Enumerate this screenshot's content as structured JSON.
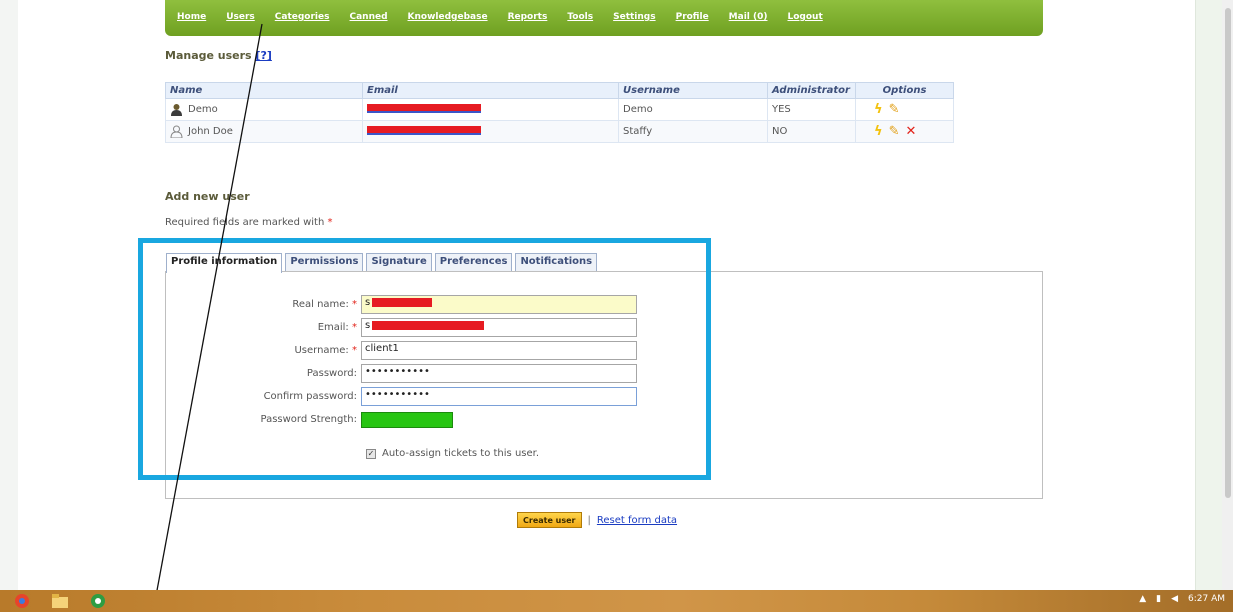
{
  "nav": {
    "items": [
      "Home",
      "Users",
      "Categories",
      "Canned",
      "Knowledgebase",
      "Reports",
      "Tools",
      "Settings",
      "Profile",
      "Mail (0)",
      "Logout"
    ]
  },
  "manage_users": {
    "title": "Manage users",
    "help": "[?]"
  },
  "users_table": {
    "headers": [
      "Name",
      "Email",
      "Username",
      "Administrator",
      "Options"
    ],
    "rows": [
      {
        "name": "Demo",
        "username": "Demo",
        "admin": "YES"
      },
      {
        "name": "John Doe",
        "username": "Staffy",
        "admin": "NO"
      }
    ]
  },
  "add_user": {
    "title": "Add new user",
    "required_note": "Required fields are marked with",
    "required_star": "*"
  },
  "tabs": [
    "Profile information",
    "Permissions",
    "Signature",
    "Preferences",
    "Notifications"
  ],
  "form": {
    "real_name_label": "Real name:",
    "real_name_value": "s",
    "email_label": "Email:",
    "email_value": "s",
    "username_label": "Username:",
    "username_value": "client1",
    "password_label": "Password:",
    "password_value": "•••••••••••",
    "confirm_label": "Confirm password:",
    "confirm_value": "•••••••••••",
    "strength_label": "Password Strength:",
    "auto_assign_label": "Auto-assign tickets to this user."
  },
  "actions": {
    "create_label": "Create user",
    "separator": "|",
    "reset_label": "Reset form data"
  },
  "taskbar": {
    "time": "6:27 AM"
  },
  "colors": {
    "nav_green": "#7cb02e",
    "highlight_box": "#19a7e0",
    "strength_green": "#27c512",
    "redaction": "#e61b22"
  }
}
